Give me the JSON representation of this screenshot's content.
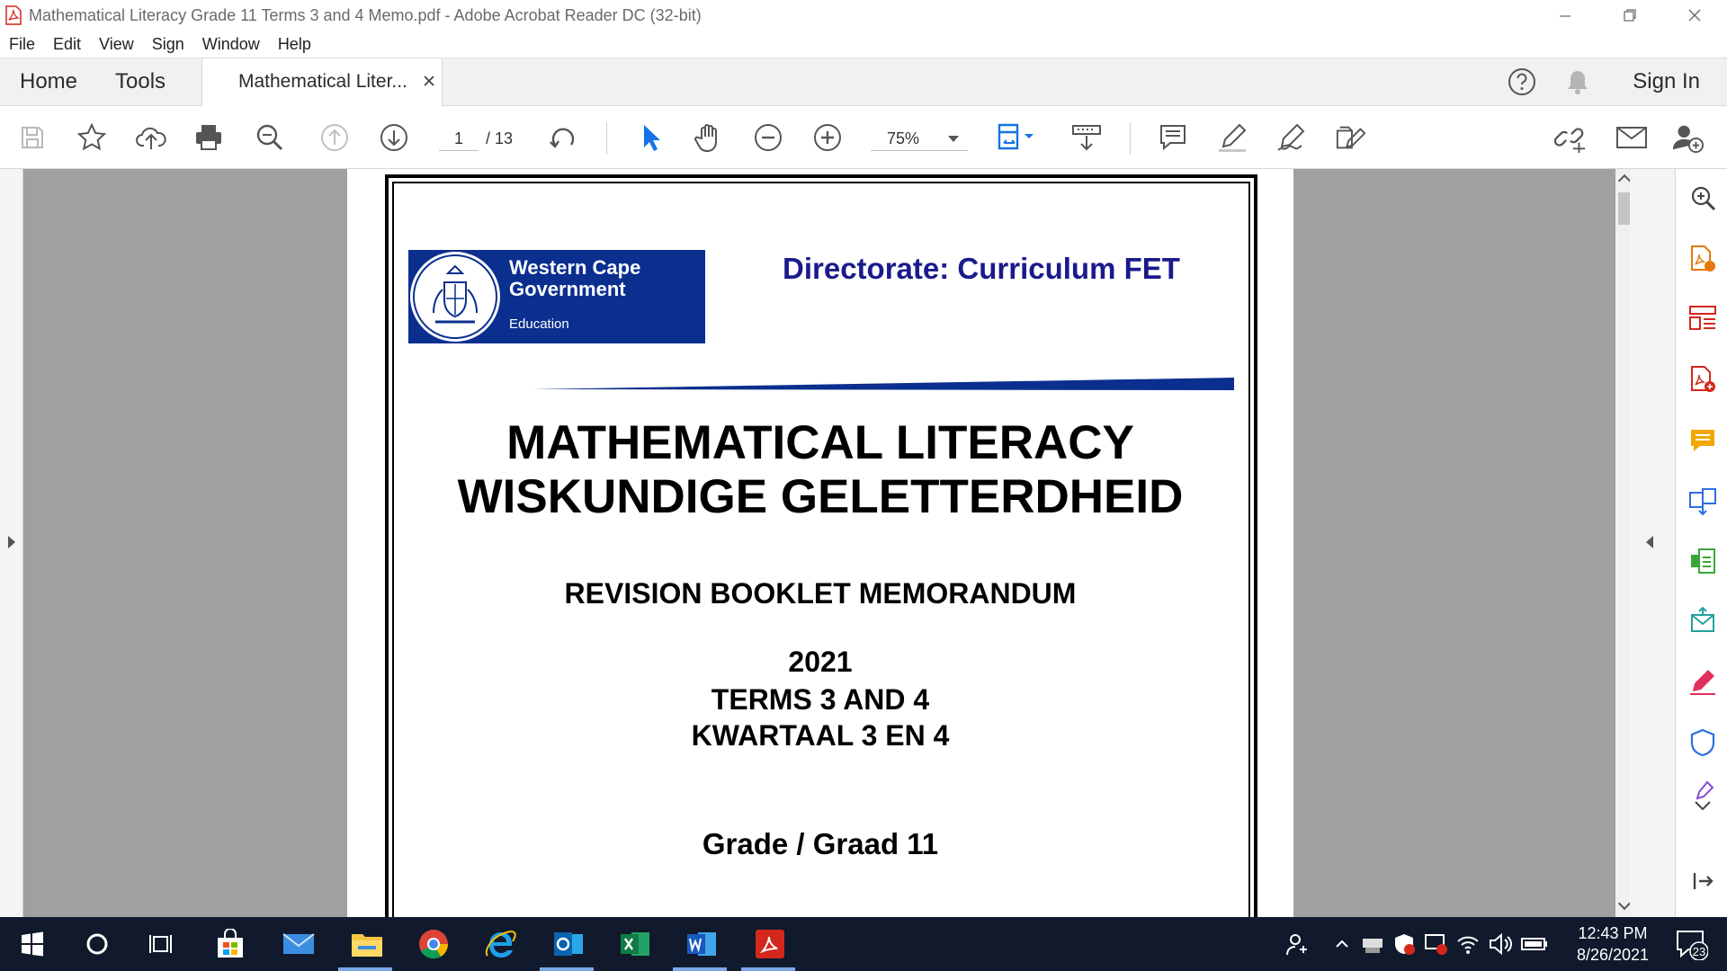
{
  "window": {
    "title": "Mathematical Literacy Grade 11 Terms 3 and 4 Memo.pdf - Adobe Acrobat Reader DC (32-bit)"
  },
  "menu": [
    "File",
    "Edit",
    "View",
    "Sign",
    "Window",
    "Help"
  ],
  "tabs": {
    "home": "Home",
    "tools": "Tools",
    "document": "Mathematical Liter...",
    "sign_in": "Sign In"
  },
  "toolbar": {
    "current_page": "1",
    "total_pages": "/ 13",
    "zoom": "75%"
  },
  "document": {
    "logo_name": "Western Cape Government",
    "logo_department": "Education",
    "directorate": "Directorate: Curriculum FET",
    "title_en": "MATHEMATICAL LITERACY",
    "title_af": "WISKUNDIGE GELETTERDHEID",
    "subtitle": "REVISION BOOKLET MEMORANDUM",
    "year": "2021",
    "terms": "TERMS 3 AND 4",
    "kwartaal": "KWARTAAL 3 EN 4",
    "grade": "Grade / Graad 11"
  },
  "taskbar": {
    "time": "12:43 PM",
    "date": "8/26/2021",
    "notifications": "23"
  },
  "colors": {
    "acrobat_red": "#d4271c",
    "wcg_blue": "#0a2f8f",
    "directorate_blue": "#1a1a8c",
    "taskbar": "#101a2c"
  }
}
